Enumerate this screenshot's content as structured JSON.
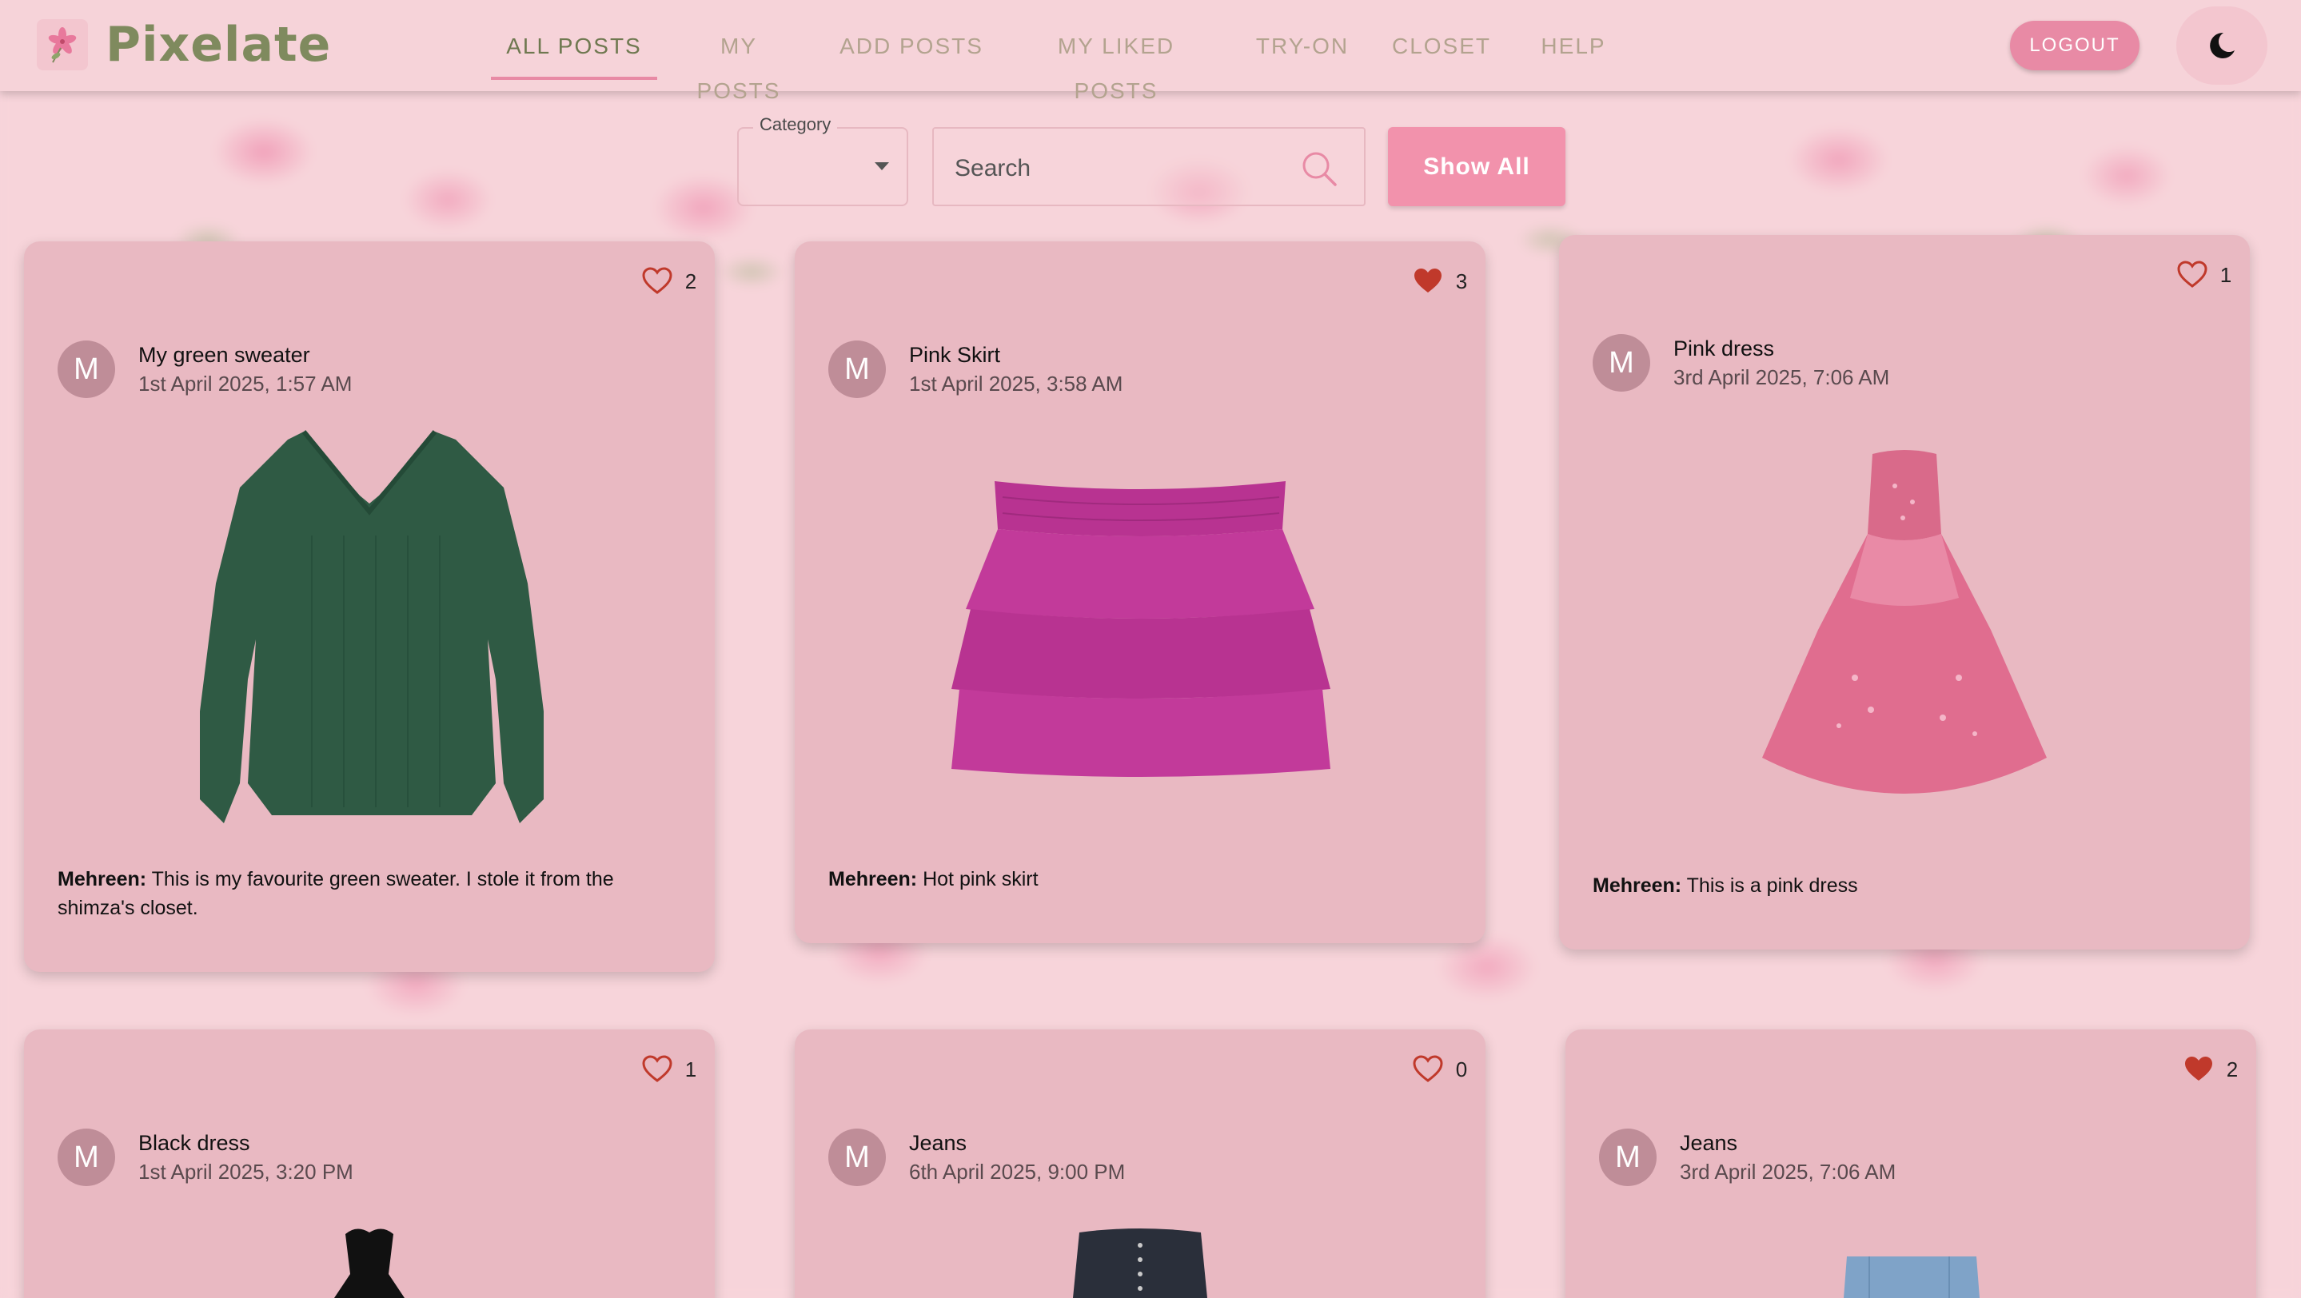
{
  "app": {
    "name": "Pixelate"
  },
  "nav": {
    "tabs": [
      {
        "label": "ALL POSTS",
        "active": true
      },
      {
        "label": "MY POSTS",
        "active": false
      },
      {
        "label": "ADD POSTS",
        "active": false
      },
      {
        "label": "MY LIKED POSTS",
        "active": false
      },
      {
        "label": "TRY-ON",
        "active": false
      },
      {
        "label": "CLOSET",
        "active": false
      },
      {
        "label": "HELP",
        "active": false
      }
    ],
    "logout_label": "LOGOUT",
    "theme_icon": "moon-icon"
  },
  "filters": {
    "category_label": "Category",
    "category_value": "",
    "search_placeholder": "Search",
    "search_value": "",
    "show_all_label": "Show All"
  },
  "colors": {
    "accent": "#e88aa5",
    "button": "#f292ac",
    "card_bg": "#e9b9c2",
    "avatar_bg": "#bf8d98",
    "like_red": "#c0392b",
    "logo_green": "#7f8a5e",
    "page_bg": "#f7d4da"
  },
  "posts": [
    {
      "title": "My green sweater",
      "date": "1st April 2025, 1:57 AM",
      "avatar": "M",
      "likes": "2",
      "liked": false,
      "author": "Mehreen:",
      "caption": "This is my favourite green sweater. I stole it from the shimza's closet.",
      "image": "green-sweater"
    },
    {
      "title": "Pink Skirt",
      "date": "1st April 2025, 3:58 AM",
      "avatar": "M",
      "likes": "3",
      "liked": true,
      "author": "Mehreen:",
      "caption": "Hot pink skirt",
      "image": "pink-skirt"
    },
    {
      "title": "Pink dress",
      "date": "3rd April 2025, 7:06 AM",
      "avatar": "M",
      "likes": "1",
      "liked": false,
      "author": "Mehreen:",
      "caption": "This is a pink dress",
      "image": "pink-dress"
    },
    {
      "title": "Black dress",
      "date": "1st April 2025, 3:20 PM",
      "avatar": "M",
      "likes": "1",
      "liked": false,
      "image": "black-dress"
    },
    {
      "title": "Jeans",
      "date": "6th April 2025, 9:00 PM",
      "avatar": "M",
      "likes": "0",
      "liked": false,
      "image": "black-jeans"
    },
    {
      "title": "Jeans",
      "date": "3rd April 2025, 7:06 AM",
      "avatar": "M",
      "likes": "2",
      "liked": true,
      "image": "blue-jeans"
    }
  ]
}
